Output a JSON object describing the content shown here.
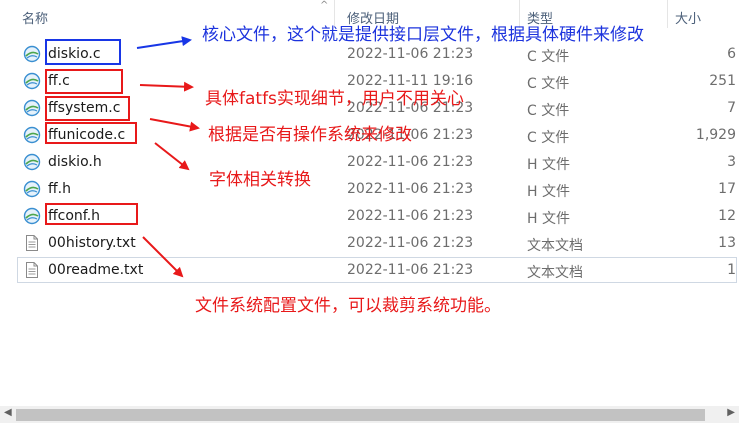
{
  "header": {
    "col_name": "名称",
    "col_date": "修改日期",
    "col_type": "类型",
    "col_size": "大小"
  },
  "files": [
    {
      "name": "diskio.c",
      "date": "2022-11-06 21:23",
      "type": "C 文件",
      "size": "6",
      "icon": "c-source-file-icon"
    },
    {
      "name": "ff.c",
      "date": "2022-11-11 19:16",
      "type": "C 文件",
      "size": "251",
      "icon": "c-source-file-icon"
    },
    {
      "name": "ffsystem.c",
      "date": "2022-11-06 21:23",
      "type": "C 文件",
      "size": "7",
      "icon": "c-source-file-icon"
    },
    {
      "name": "ffunicode.c",
      "date": "2022-11-06 21:23",
      "type": "C 文件",
      "size": "1,929",
      "icon": "c-source-file-icon"
    },
    {
      "name": "diskio.h",
      "date": "2022-11-06 21:23",
      "type": "H 文件",
      "size": "3",
      "icon": "h-header-file-icon"
    },
    {
      "name": "ff.h",
      "date": "2022-11-06 21:23",
      "type": "H 文件",
      "size": "17",
      "icon": "h-header-file-icon"
    },
    {
      "name": "ffconf.h",
      "date": "2022-11-06 21:23",
      "type": "H 文件",
      "size": "12",
      "icon": "h-header-file-icon"
    },
    {
      "name": "00history.txt",
      "date": "2022-11-06 21:23",
      "type": "文本文档",
      "size": "13",
      "icon": "text-document-icon"
    },
    {
      "name": "00readme.txt",
      "date": "2022-11-06 21:23",
      "type": "文本文档",
      "size": "1",
      "icon": "text-document-icon"
    }
  ],
  "annotations": {
    "diskio": "核心文件，这个就是提供接口层文件，根据具体硬件来修改",
    "ffc": "具体fatfs实现细节，用户不用关心",
    "ffsystem": "根据是否有操作系统来修改",
    "ffunicode": "字体相关转换",
    "ffconf": "文件系统配置文件，可以裁剪系统功能。"
  },
  "colors": {
    "annotation_red": "#e8191a",
    "annotation_blue": "#1c33dd"
  }
}
